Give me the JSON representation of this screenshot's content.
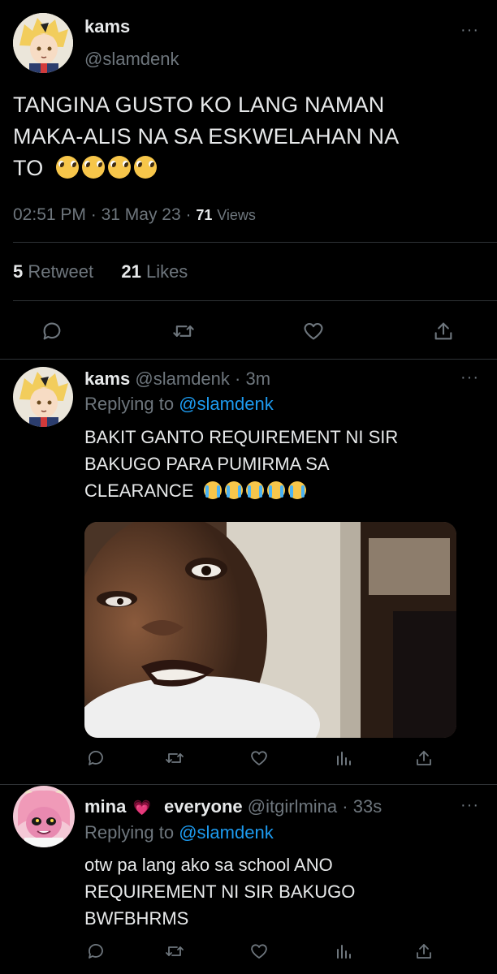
{
  "main_tweet": {
    "author_name": "kams",
    "handle": "@slamdenk",
    "text_lines": [
      "TANGINA GUSTO KO LANG NAMAN",
      "MAKA-ALIS NA SA ESKWELAHAN NA",
      "TO"
    ],
    "emojis": [
      "pleading-face",
      "pleading-face",
      "pleading-face",
      "pleading-face"
    ],
    "time": "02:51 PM",
    "separator": "·",
    "date": "31 May 23",
    "views_count": "71",
    "views_label": "Views",
    "retweet_count": "5",
    "retweet_label": "Retweet",
    "likes_count": "21",
    "likes_label": "Likes",
    "more_label": "···",
    "actions": [
      "reply-icon",
      "retweet-icon",
      "like-icon",
      "share-icon"
    ]
  },
  "replies": [
    {
      "author_name": "kams",
      "handle": "@slamdenk",
      "separator": "·",
      "time": "3m",
      "replying_prefix": "Replying to",
      "replying_to": "@slamdenk",
      "text_lines": [
        "BAKIT GANTO REQUIREMENT NI SIR",
        "BAKUGO PARA PUMIRMA SA",
        "CLEARANCE"
      ],
      "emojis": [
        "loudly-crying-face",
        "loudly-crying-face",
        "loudly-crying-face",
        "loudly-crying-face",
        "loudly-crying-face"
      ],
      "has_media": true,
      "more_label": "···",
      "actions": [
        "reply-icon",
        "retweet-icon",
        "like-icon",
        "analytics-icon",
        "share-icon"
      ]
    },
    {
      "author_name": "mina",
      "name_emoji": "💗",
      "name_extra": "everyone",
      "handle": "@itgirlmina",
      "separator": "·",
      "time": "33s",
      "replying_prefix": "Replying to",
      "replying_to": "@slamdenk",
      "text_lines": [
        "otw pa lang ako sa school ANO",
        "REQUIREMENT NI SIR BAKUGO",
        "BWFBHRMS"
      ],
      "more_label": "···",
      "actions": [
        "reply-icon",
        "retweet-icon",
        "like-icon",
        "analytics-icon",
        "share-icon"
      ]
    }
  ],
  "colors": {
    "background": "#000000",
    "text": "#e7e9ea",
    "muted": "#6e767d",
    "link": "#1d9bf0",
    "divider": "#2f3336"
  }
}
